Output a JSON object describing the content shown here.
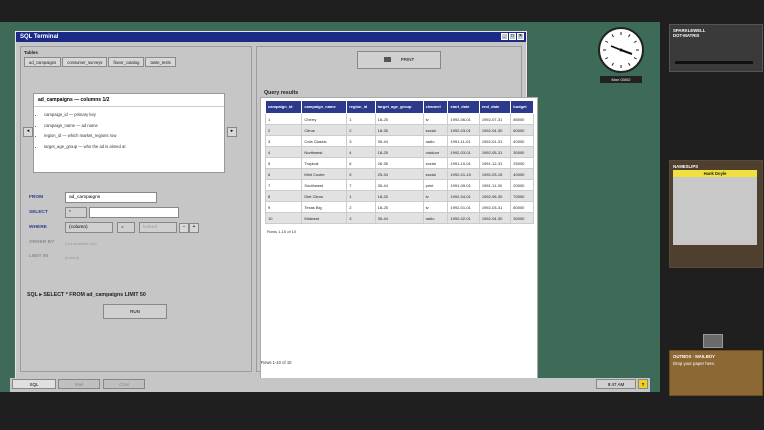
{
  "window": {
    "title": "SQL Terminal"
  },
  "tables": {
    "label": "Tables",
    "tabs": [
      "ad_campaigns",
      "consumer_surveys",
      "flavor_catalog",
      "taste_tests"
    ]
  },
  "columns_box": {
    "header": "ad_campaigns — columns  1/2",
    "items": [
      "campaign_id  —  primary key",
      "campaign_name  —  ad name",
      "region_id  —  which market_regions row",
      "target_age_group  —  who the ad is aimed at"
    ]
  },
  "query_builder": {
    "from_label": "FROM",
    "from_value": "ad_campaigns",
    "select_label": "SELECT",
    "select_value": "*",
    "where_label": "WHERE",
    "where_column": "(column)",
    "where_op": "=",
    "where_value": "locked",
    "orderby_label": "ORDER BY",
    "orderby_note": "(not available yet)",
    "limit_label": "LIMIT 50",
    "limit_note": "(locked)",
    "sql_line": "SQL ▸ SELECT * FROM ad_campaigns LIMIT 50",
    "run_label": "RUN"
  },
  "results": {
    "print_label": "PRINT",
    "title": "Query results",
    "columns": [
      "campaign_id",
      "campaign_name",
      "region_id",
      "target_age_group",
      "channel",
      "start_date",
      "end_date",
      "budget"
    ],
    "rows": [
      [
        "1",
        "Cherry",
        "1",
        "18-25",
        "tv",
        "1992-06-01",
        "1992-07-31",
        "85000"
      ],
      [
        "2",
        "Citrus",
        "2",
        "18-35",
        "social",
        "1992-03-01",
        "1992-04-30",
        "60000"
      ],
      [
        "3",
        "Cola Classic",
        "3",
        "35-44",
        "radio",
        "1991-11-01",
        "1992-01-31",
        "40000"
      ],
      [
        "4",
        "Northwest",
        "4",
        "18-25",
        "outdoor",
        "1992-03-01",
        "1992-05-31",
        "30000"
      ],
      [
        "5",
        "Tropical",
        "6",
        "26-35",
        "social",
        "1991-10-01",
        "1991-12-31",
        "25000"
      ],
      [
        "6",
        "Mint Cooler",
        "5",
        "25-34",
        "social",
        "1992-01-15",
        "1992-03-15",
        "40000"
      ],
      [
        "7",
        "Southwest",
        "7",
        "35-44",
        "print",
        "1991-09-01",
        "1991-11-30",
        "20000"
      ],
      [
        "8",
        "Diet Citrus",
        "1",
        "18-25",
        "tv",
        "1992-04-01",
        "1992-06-30",
        "70000"
      ],
      [
        "9",
        "Texas Big",
        "2",
        "18-25",
        "tv",
        "1992-01-01",
        "1992-03-31",
        "80000"
      ],
      [
        "10",
        "Midwest",
        "3",
        "35-44",
        "radio",
        "1992-02-01",
        "1992-04-30",
        "30000"
      ]
    ],
    "rows_info": "Rows 1-10 of 10",
    "footer": "Rows 1-10 of 10"
  },
  "taskbar": {
    "buttons": [
      "SQL",
      "Mail",
      "Chat"
    ],
    "time": "9:47 AM",
    "help": "?"
  },
  "clock": {
    "date": "Mon 03/02"
  },
  "widgets": {
    "printer_title": "SPARKLEWELL\nDOT-MATRIX",
    "nameslips_title": "NAMESLIPS",
    "nameslips_card": "Hank Doyle",
    "outbox_title": "OUTBOX · MAILBOY",
    "outbox_text": "Drop your paper here."
  }
}
